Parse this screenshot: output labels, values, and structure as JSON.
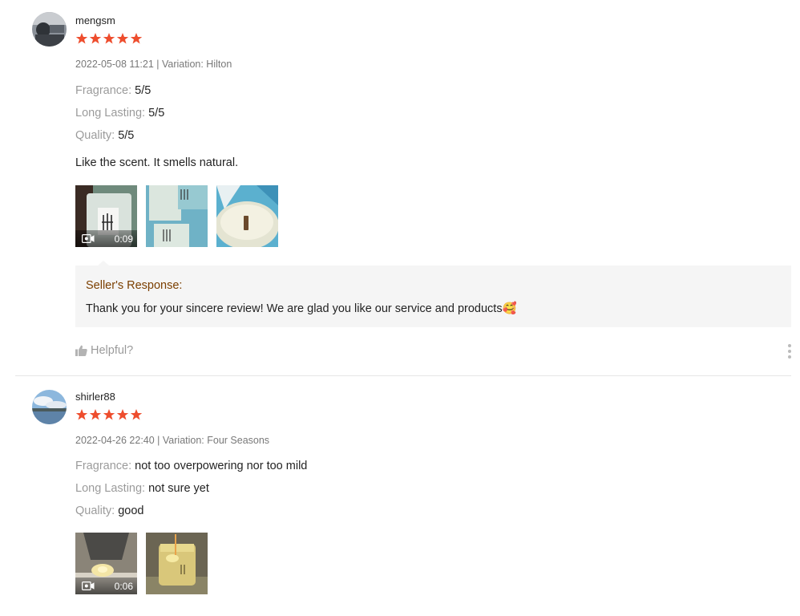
{
  "reviews": [
    {
      "username": "mengsm",
      "rating": 5,
      "meta": "2022-05-08 11:21 | Variation: Hilton",
      "attributes": [
        {
          "key": "Fragrance:",
          "value": "5/5"
        },
        {
          "key": "Long Lasting:",
          "value": "5/5"
        },
        {
          "key": "Quality:",
          "value": "5/5"
        }
      ],
      "comment": "Like the scent.  It smells natural.",
      "media": [
        {
          "type": "video",
          "duration": "0:09"
        },
        {
          "type": "image"
        },
        {
          "type": "image"
        }
      ],
      "seller_response": {
        "title": "Seller's Response:",
        "text": "Thank you for your sincere review! We are glad you like our service and products🥰"
      },
      "helpful_label": "Helpful?"
    },
    {
      "username": "shirler88",
      "rating": 5,
      "meta": "2022-04-26 22:40 | Variation: Four Seasons",
      "attributes": [
        {
          "key": "Fragrance:",
          "value": "not too overpowering nor too mild"
        },
        {
          "key": "Long Lasting:",
          "value": "not sure yet"
        },
        {
          "key": "Quality:",
          "value": "good"
        }
      ],
      "media": [
        {
          "type": "video",
          "duration": "0:06"
        },
        {
          "type": "image"
        }
      ]
    }
  ],
  "colors": {
    "star": "#ee4d2d",
    "seller_title": "#7b3f00",
    "response_bg": "#f5f5f5"
  },
  "icons": {
    "star": "star-icon",
    "video": "video-camera-icon",
    "thumb_up": "thumbs-up-icon",
    "more": "more-vertical-icon"
  }
}
